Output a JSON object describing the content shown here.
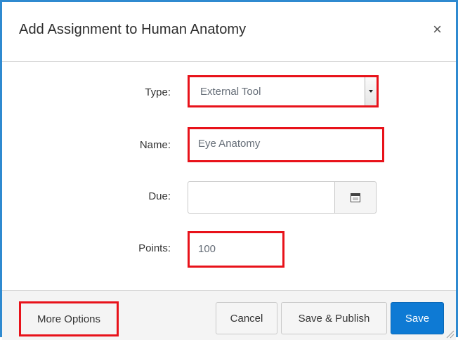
{
  "dialog": {
    "title": "Add Assignment to Human Anatomy",
    "close_label": "×"
  },
  "form": {
    "type_label": "Type:",
    "type_value": "External Tool",
    "name_label": "Name:",
    "name_value": "Eye Anatomy",
    "due_label": "Due:",
    "due_value": "",
    "points_label": "Points:",
    "points_value": "100"
  },
  "footer": {
    "more_options_label": "More Options",
    "cancel_label": "Cancel",
    "save_publish_label": "Save & Publish",
    "save_label": "Save"
  },
  "colors": {
    "accent_border": "#2f8ad0",
    "highlight": "#e8121a",
    "primary_button": "#0e7ad4"
  },
  "icons": {
    "close": "close-icon",
    "dropdown": "chevron-down-icon",
    "calendar": "calendar-icon",
    "resize": "resize-grip-icon"
  }
}
